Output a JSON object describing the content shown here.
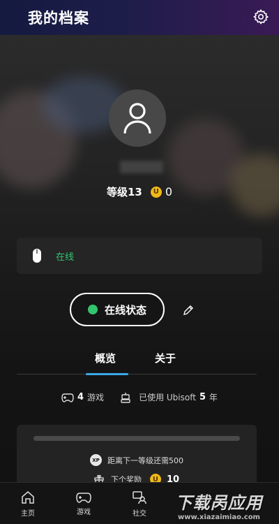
{
  "header": {
    "title": "我的档案",
    "settings_icon": "gear-icon"
  },
  "profile": {
    "level_label": "等级13",
    "coin_symbol": "U",
    "coin_value": "0",
    "status_text": "在线",
    "status_button_label": "在线状态",
    "status_color": "#33c46e"
  },
  "tabs": [
    {
      "label": "概览",
      "active": true
    },
    {
      "label": "关于",
      "active": false
    }
  ],
  "stats": {
    "games_count": "4",
    "games_label": "游戏",
    "ubisoft_prefix": "已使用 Ubisoft",
    "ubisoft_years": "5",
    "years_label": "年"
  },
  "xp": {
    "badge": "XP",
    "next_level_text": "距离下一等级还需500",
    "reward_label": "下个奖励",
    "reward_value": "10"
  },
  "bottom_nav": [
    {
      "label": "主页",
      "icon": "home-icon"
    },
    {
      "label": "游戏",
      "icon": "gamepad-icon"
    },
    {
      "label": "社交",
      "icon": "social-icon"
    }
  ],
  "watermark": {
    "main": "下载呙应用",
    "url": "www.xiazaimiao.com"
  },
  "colors": {
    "accent_blue": "#3aa8e8",
    "online_green": "#33c46e",
    "coin_gold": "#f0b81a"
  }
}
